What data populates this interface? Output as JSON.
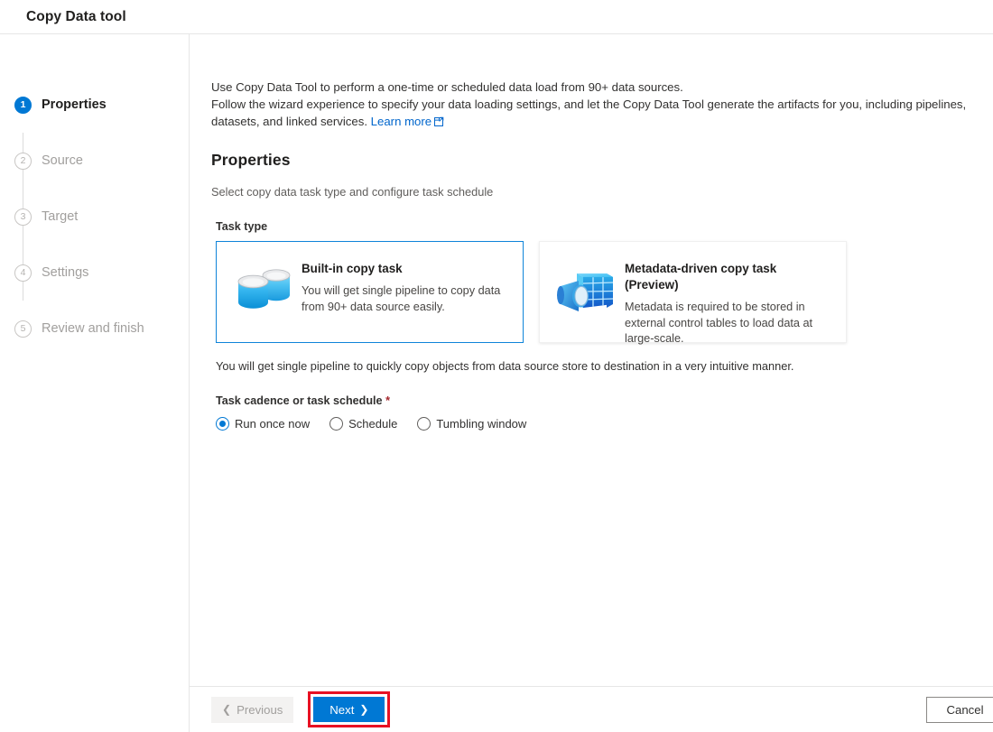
{
  "window": {
    "title": "Copy Data tool"
  },
  "sidebar": {
    "steps": [
      {
        "number": "1",
        "label": "Properties",
        "state": "active"
      },
      {
        "number": "2",
        "label": "Source",
        "state": "inactive"
      },
      {
        "number": "3",
        "label": "Target",
        "state": "inactive"
      },
      {
        "number": "4",
        "label": "Settings",
        "state": "inactive"
      },
      {
        "number": "5",
        "label": "Review and finish",
        "state": "inactive"
      }
    ]
  },
  "main": {
    "intro": {
      "line1": "Use Copy Data Tool to perform a one-time or scheduled data load from 90+ data sources.",
      "line2": "Follow the wizard experience to specify your data loading settings, and let the Copy Data Tool generate the artifacts for you, including pipelines, datasets, and linked services.",
      "link_label": "Learn more",
      "link_icon": "external-link-icon"
    },
    "section_title": "Properties",
    "subtitle": "Select copy data task type and configure task schedule",
    "task_type": {
      "label": "Task type",
      "cards": [
        {
          "title": "Built-in copy task",
          "description": "You will get single pipeline to copy data from 90+ data source easily.",
          "icon": "database-copy-icon",
          "selected": true
        },
        {
          "title": "Metadata-driven copy task (Preview)",
          "description": "Metadata is required to be stored in external control tables to load data at large-scale.",
          "icon": "metadata-table-search-icon",
          "selected": false
        }
      ]
    },
    "helper_text": "You will get single pipeline to quickly copy objects from data source store to destination in a very intuitive manner.",
    "cadence": {
      "label": "Task cadence or task schedule",
      "required_marker": "*",
      "options": [
        {
          "label": "Run once now",
          "checked": true
        },
        {
          "label": "Schedule",
          "checked": false
        },
        {
          "label": "Tumbling window",
          "checked": false
        }
      ]
    }
  },
  "footer": {
    "previous_label": "Previous",
    "previous_icon": "chevron-left-icon",
    "next_label": "Next",
    "next_icon": "chevron-right-icon",
    "cancel_label": "Cancel",
    "highlight_color": "#e81123"
  },
  "colors": {
    "accent": "#0078d4",
    "link": "#0066cc",
    "required": "#a4262c",
    "border": "#e6e6e6"
  }
}
